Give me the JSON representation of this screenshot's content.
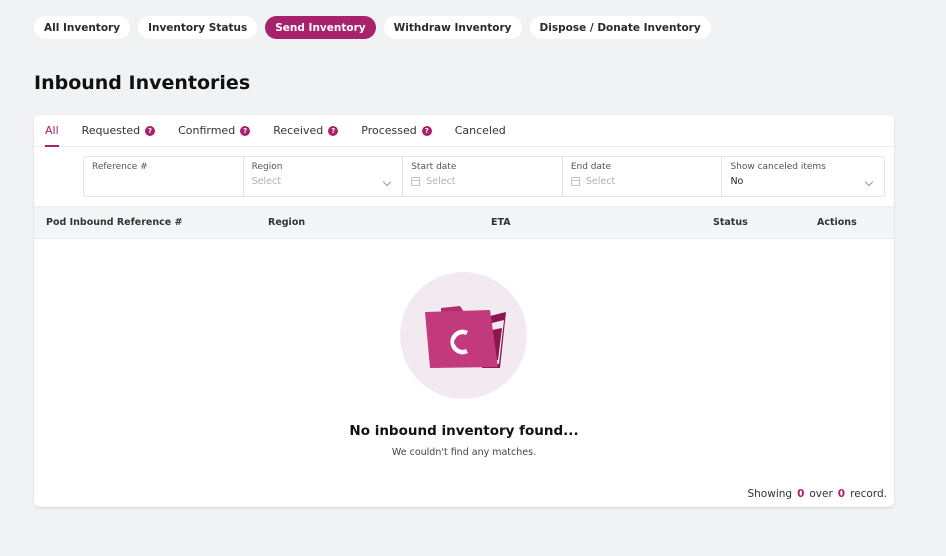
{
  "top_tabs": [
    {
      "label": "All Inventory",
      "active": false
    },
    {
      "label": "Inventory Status",
      "active": false
    },
    {
      "label": "Send Inventory",
      "active": true
    },
    {
      "label": "Withdraw Inventory",
      "active": false
    },
    {
      "label": "Dispose / Donate Inventory",
      "active": false
    }
  ],
  "page": {
    "title": "Inbound Inventories"
  },
  "status_tabs": [
    {
      "label": "All"
    },
    {
      "label": "Requested",
      "help": "?"
    },
    {
      "label": "Confirmed",
      "help": "?"
    },
    {
      "label": "Received",
      "help": "?"
    },
    {
      "label": "Processed",
      "help": "?"
    },
    {
      "label": "Canceled"
    }
  ],
  "filters": {
    "reference": {
      "label": "Reference #",
      "value": ""
    },
    "region": {
      "label": "Region",
      "placeholder": "Select"
    },
    "start_date": {
      "label": "Start date",
      "placeholder": "Select"
    },
    "end_date": {
      "label": "End date",
      "placeholder": "Select"
    },
    "show_canceled": {
      "label": "Show canceled items",
      "value": "No"
    }
  },
  "table": {
    "columns": [
      "Pod Inbound Reference #",
      "Region",
      "ETA",
      "Status",
      "Actions"
    ]
  },
  "empty_state": {
    "title": "No inbound inventory found...",
    "subtitle": "We couldn't find any matches."
  },
  "footer": {
    "showing_label": "Showing",
    "count": "0",
    "over_label": "over",
    "total": "0",
    "record_label": "record."
  },
  "colors": {
    "accent": "#a8216b",
    "background": "#f0f2f3"
  },
  "icons": {
    "empty": "folder-icon",
    "calendar": "calendar-icon",
    "dropdown": "chevron-down-icon"
  }
}
